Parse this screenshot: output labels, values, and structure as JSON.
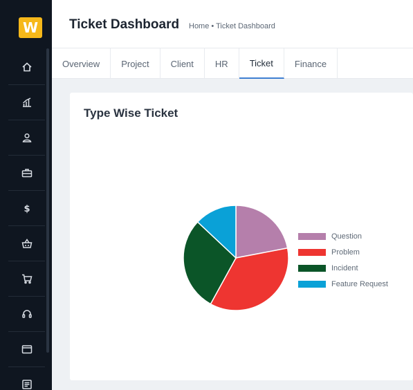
{
  "app": {
    "logo_text": "W"
  },
  "sidebar": {
    "items": [
      {
        "icon": "home-icon"
      },
      {
        "icon": "chart-icon"
      },
      {
        "icon": "user-icon"
      },
      {
        "icon": "briefcase-icon"
      },
      {
        "icon": "dollar-icon"
      },
      {
        "icon": "basket-icon"
      },
      {
        "icon": "cart-icon"
      },
      {
        "icon": "headset-icon"
      },
      {
        "icon": "wallet-icon"
      },
      {
        "icon": "document-icon"
      }
    ]
  },
  "header": {
    "title": "Ticket Dashboard",
    "breadcrumb": {
      "home": "Home",
      "separator": "•",
      "current": "Ticket Dashboard"
    }
  },
  "tabs": [
    {
      "label": "Overview",
      "active": false
    },
    {
      "label": "Project",
      "active": false
    },
    {
      "label": "Client",
      "active": false
    },
    {
      "label": "HR",
      "active": false
    },
    {
      "label": "Ticket",
      "active": true
    },
    {
      "label": "Finance",
      "active": false
    }
  ],
  "card": {
    "title": "Type Wise Ticket"
  },
  "chart_data": {
    "type": "pie",
    "title": "Type Wise Ticket",
    "categories": [
      "Question",
      "Problem",
      "Incident",
      "Feature Request"
    ],
    "values": [
      22,
      36,
      29,
      13
    ],
    "colors": [
      "#b57fab",
      "#ee3531",
      "#0b5528",
      "#0aa1d7"
    ],
    "legend": "right"
  }
}
